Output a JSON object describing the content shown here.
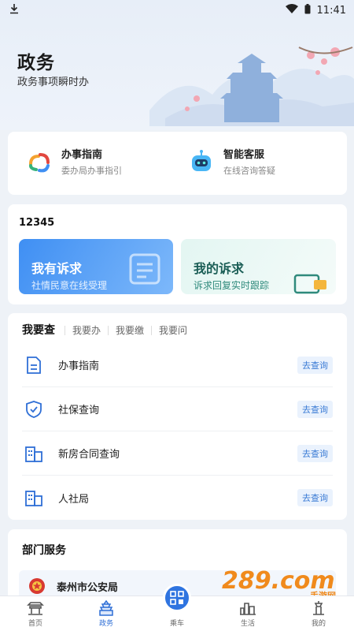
{
  "status": {
    "time": "11:41"
  },
  "hero": {
    "title": "政务",
    "subtitle": "政务事项瞬时办"
  },
  "services": [
    {
      "title": "办事指南",
      "desc": "委办局办事指引"
    },
    {
      "title": "智能客服",
      "desc": "在线咨询答疑"
    }
  ],
  "hotline": {
    "number": "12345",
    "banner_a": {
      "title": "我有诉求",
      "subtitle": "社情民意在线受理"
    },
    "banner_b": {
      "title": "我的诉求",
      "subtitle": "诉求回复实时跟踪"
    }
  },
  "query": {
    "tabs": [
      "我要查",
      "我要办",
      "我要缴",
      "我要问"
    ],
    "rows": [
      {
        "label": "办事指南",
        "button": "去查询"
      },
      {
        "label": "社保查询",
        "button": "去查询"
      },
      {
        "label": "新房合同查询",
        "button": "去查询"
      },
      {
        "label": "人社局",
        "button": "去查询"
      }
    ]
  },
  "dept": {
    "title": "部门服务",
    "items": [
      {
        "name": "泰州市公安局"
      }
    ]
  },
  "tabbar": [
    {
      "label": "首页",
      "active": false
    },
    {
      "label": "政务",
      "active": true
    },
    {
      "label": "乘车",
      "active": false
    },
    {
      "label": "生活",
      "active": false
    },
    {
      "label": "我的",
      "active": false
    }
  ],
  "watermark": {
    "text": "289.com",
    "sub": "手游网"
  },
  "colors": {
    "accent": "#2f74e0",
    "background": "#eef2f7",
    "card": "#ffffff"
  }
}
